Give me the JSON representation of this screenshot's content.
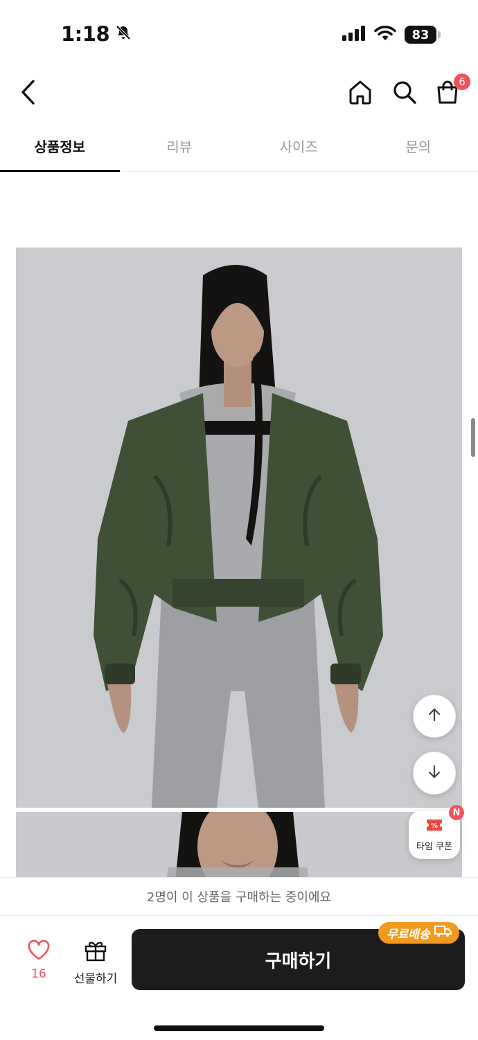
{
  "status_bar": {
    "time": "1:18",
    "battery": "83"
  },
  "header": {
    "cart_count": "6"
  },
  "tabs": [
    {
      "label": "상품정보",
      "active": true
    },
    {
      "label": "리뷰",
      "active": false
    },
    {
      "label": "사이즈",
      "active": false
    },
    {
      "label": "문의",
      "active": false
    }
  ],
  "floating": {
    "coupon_label": "타임 쿠폰",
    "coupon_badge": "N"
  },
  "notice": {
    "text": "2명이 이 상품을 구매하는 중이에요"
  },
  "bottom_bar": {
    "like_count": "16",
    "gift_label": "선물하기",
    "buy_label": "구매하기",
    "free_shipping_label": "무료배송"
  },
  "colors": {
    "accent_red": "#f2535b",
    "shipping_orange": "#f29a1f",
    "buy_button": "#1c1c1c"
  }
}
